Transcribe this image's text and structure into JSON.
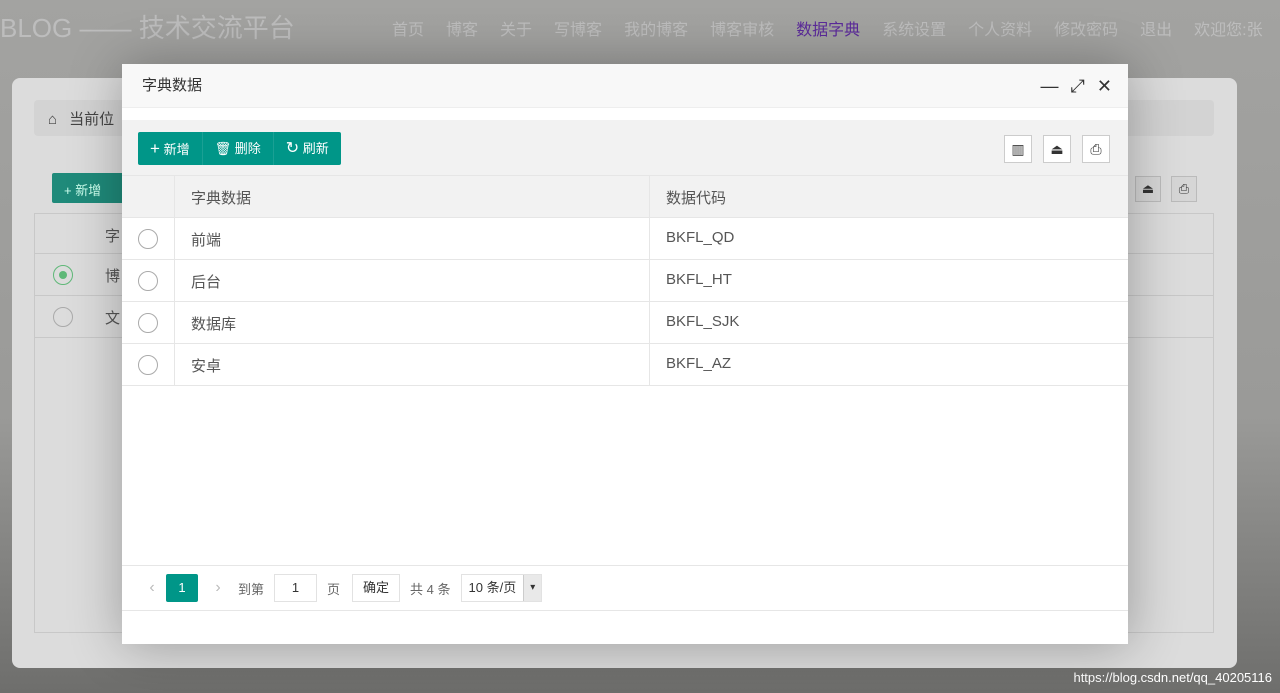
{
  "nav": {
    "brand": "BLOG —— 技术交流平台",
    "items": [
      "首页",
      "博客",
      "关于",
      "写博客",
      "我的博客",
      "博客审核",
      "数据字典",
      "系统设置",
      "个人资料",
      "修改密码",
      "退出",
      "欢迎您:张"
    ],
    "active_index": 6
  },
  "background": {
    "breadcrumb": "当前位",
    "add_label": "新增",
    "rows": [
      "字",
      "博",
      "文"
    ]
  },
  "modal": {
    "title": "字典数据",
    "toolbar": {
      "add": "新增",
      "delete": "删除",
      "refresh": "刷新"
    },
    "columns": [
      "字典数据",
      "数据代码"
    ],
    "rows": [
      {
        "name": "前端",
        "code": "BKFL_QD"
      },
      {
        "name": "后台",
        "code": "BKFL_HT"
      },
      {
        "name": "数据库",
        "code": "BKFL_SJK"
      },
      {
        "name": "安卓",
        "code": "BKFL_AZ"
      }
    ],
    "pager": {
      "current": "1",
      "goto_label": "到第",
      "goto_value": "1",
      "page_label": "页",
      "confirm": "确定",
      "total": "共 4 条",
      "page_size": "10 条/页"
    }
  },
  "watermark": "https://blog.csdn.net/qq_40205116",
  "colors": {
    "primary": "#009688",
    "active_nav": "#5b2a9a"
  }
}
